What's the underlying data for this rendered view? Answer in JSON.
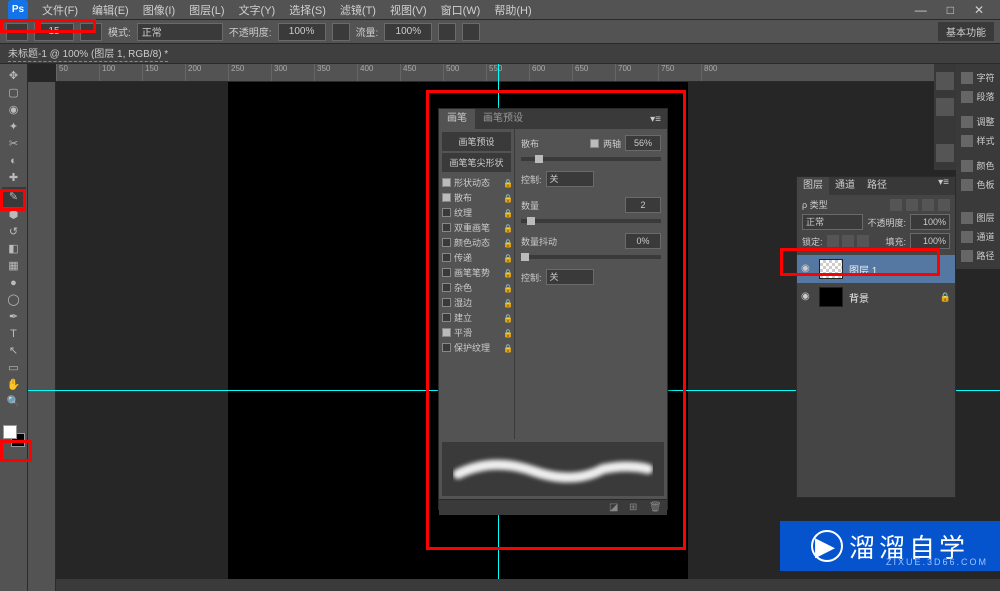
{
  "menubar": [
    "文件(F)",
    "编辑(E)",
    "图像(I)",
    "图层(L)",
    "文字(Y)",
    "选择(S)",
    "滤镜(T)",
    "视图(V)",
    "窗口(W)",
    "帮助(H)"
  ],
  "options": {
    "size": "15",
    "mode_label": "模式:",
    "mode_value": "正常",
    "opacity_label": "不透明度:",
    "opacity_value": "100%",
    "flow_label": "流量:",
    "flow_value": "100%",
    "basic_label": "基本功能"
  },
  "doc_tab": "未标题-1 @ 100% (图层 1, RGB/8) *",
  "ruler_ticks": [
    "50",
    "100",
    "150",
    "200",
    "250",
    "300",
    "350",
    "400",
    "450",
    "500",
    "550",
    "600",
    "650",
    "700",
    "750",
    "800"
  ],
  "brush_panel": {
    "tabs": [
      "画笔",
      "画笔预设"
    ],
    "preset_btn": "画笔预设",
    "tip_shape": "画笔笔尖形状",
    "rows": [
      {
        "label": "形状动态",
        "checked": true
      },
      {
        "label": "散布",
        "checked": true
      },
      {
        "label": "纹理",
        "checked": false
      },
      {
        "label": "双重画笔",
        "checked": false
      },
      {
        "label": "颜色动态",
        "checked": false
      },
      {
        "label": "传递",
        "checked": false
      },
      {
        "label": "画笔笔势",
        "checked": false
      },
      {
        "label": "杂色",
        "checked": false
      },
      {
        "label": "湿边",
        "checked": false
      },
      {
        "label": "建立",
        "checked": false
      },
      {
        "label": "平滑",
        "checked": true
      },
      {
        "label": "保护纹理",
        "checked": false
      }
    ],
    "scatter_label": "散布",
    "both_axes_label": "两轴",
    "both_axes_checked": true,
    "scatter_value": "56%",
    "control_label": "控制:",
    "control_value": "关",
    "count_label": "数量",
    "count_value": "2",
    "jitter_label": "数量抖动",
    "jitter_value": "0%",
    "control2_label": "控制:",
    "control2_value": "关"
  },
  "layers": {
    "tabs": [
      "图层",
      "通道",
      "路径"
    ],
    "kind_label": "ρ 类型",
    "blend_mode": "正常",
    "opacity_label": "不透明度:",
    "opacity_value": "100%",
    "lock_label": "锁定:",
    "fill_label": "填充:",
    "fill_value": "100%",
    "items": [
      {
        "name": "图层 1",
        "selected": true,
        "visible": true,
        "locked": false,
        "thumb": "checker"
      },
      {
        "name": "背景",
        "selected": false,
        "visible": true,
        "locked": true,
        "thumb": "black"
      }
    ]
  },
  "dock_labels": [
    "字符",
    "段落",
    "调整",
    "样式",
    "颜色",
    "色板",
    "图层",
    "通道",
    "路径"
  ],
  "watermark": {
    "title": "溜溜自学",
    "url": "ZIXUE.3D66.COM"
  }
}
